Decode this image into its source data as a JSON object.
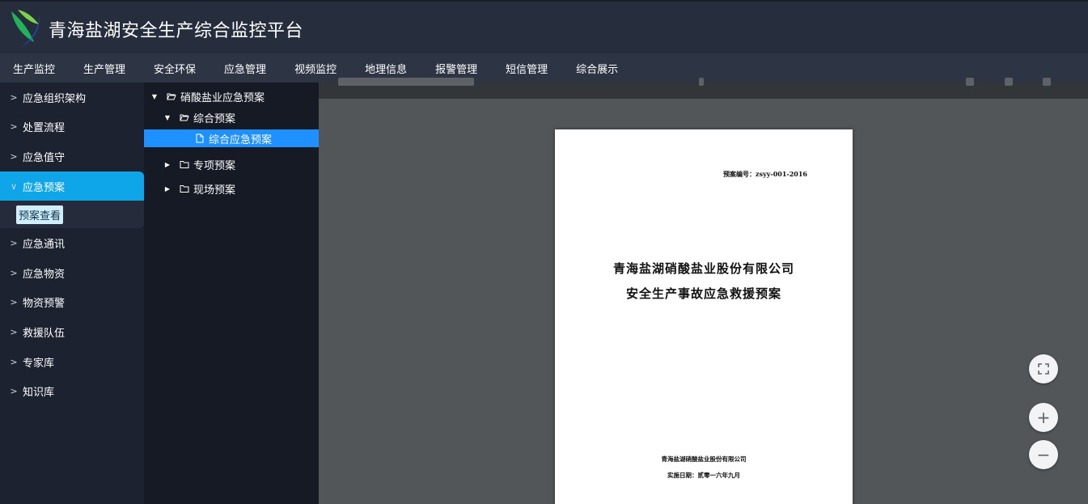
{
  "app": {
    "title": "青海盐湖安全生产综合监控平台",
    "logo_icon": "leaf-logo-icon"
  },
  "topnav": {
    "items": [
      {
        "label": "生产监控"
      },
      {
        "label": "生产管理"
      },
      {
        "label": "安全环保"
      },
      {
        "label": "应急管理"
      },
      {
        "label": "视频监控"
      },
      {
        "label": "地理信息"
      },
      {
        "label": "报警管理"
      },
      {
        "label": "短信管理"
      },
      {
        "label": "综合展示"
      }
    ]
  },
  "sidebar": {
    "items": [
      {
        "label": "应急组织架构",
        "icon": "chevron-right-icon"
      },
      {
        "label": "处置流程",
        "icon": "chevron-right-icon"
      },
      {
        "label": "应急值守",
        "icon": "chevron-right-icon"
      },
      {
        "label": "应急预案",
        "icon": "chevron-down-icon",
        "active": true
      },
      {
        "label": "应急通讯",
        "icon": "chevron-right-icon"
      },
      {
        "label": "应急物资",
        "icon": "chevron-right-icon"
      },
      {
        "label": "物资预警",
        "icon": "chevron-right-icon"
      },
      {
        "label": "救援队伍",
        "icon": "chevron-right-icon"
      },
      {
        "label": "专家库",
        "icon": "chevron-right-icon"
      },
      {
        "label": "知识库",
        "icon": "chevron-right-icon"
      }
    ],
    "sub_item": {
      "label": "预案查看"
    },
    "accent_color": "#0ea5e9"
  },
  "tree": {
    "nodes": [
      {
        "label": "硝酸盐业应急预案",
        "expanded": true,
        "type": "folder-open"
      },
      {
        "label": "综合预案",
        "expanded": true,
        "type": "folder-open"
      },
      {
        "label": "综合应急预案",
        "selected": true,
        "type": "file"
      },
      {
        "label": "专项预案",
        "expanded": false,
        "type": "folder"
      },
      {
        "label": "现场预案",
        "expanded": false,
        "type": "folder"
      }
    ],
    "selected_color": "#1e90ff"
  },
  "document": {
    "code": "预案编号：zsyy-001-2016",
    "title_line1": "青海盐湖硝酸盐业股份有限公司",
    "title_line2": "安全生产事故应急救援预案",
    "company": "青海盐湖硝酸盐业股份有限公司",
    "date": "实施日期：贰零一六年九月"
  },
  "viewer_controls": {
    "fit_icon": "fit-to-page-icon",
    "zoom_in_label": "+",
    "zoom_out_label": "−"
  }
}
